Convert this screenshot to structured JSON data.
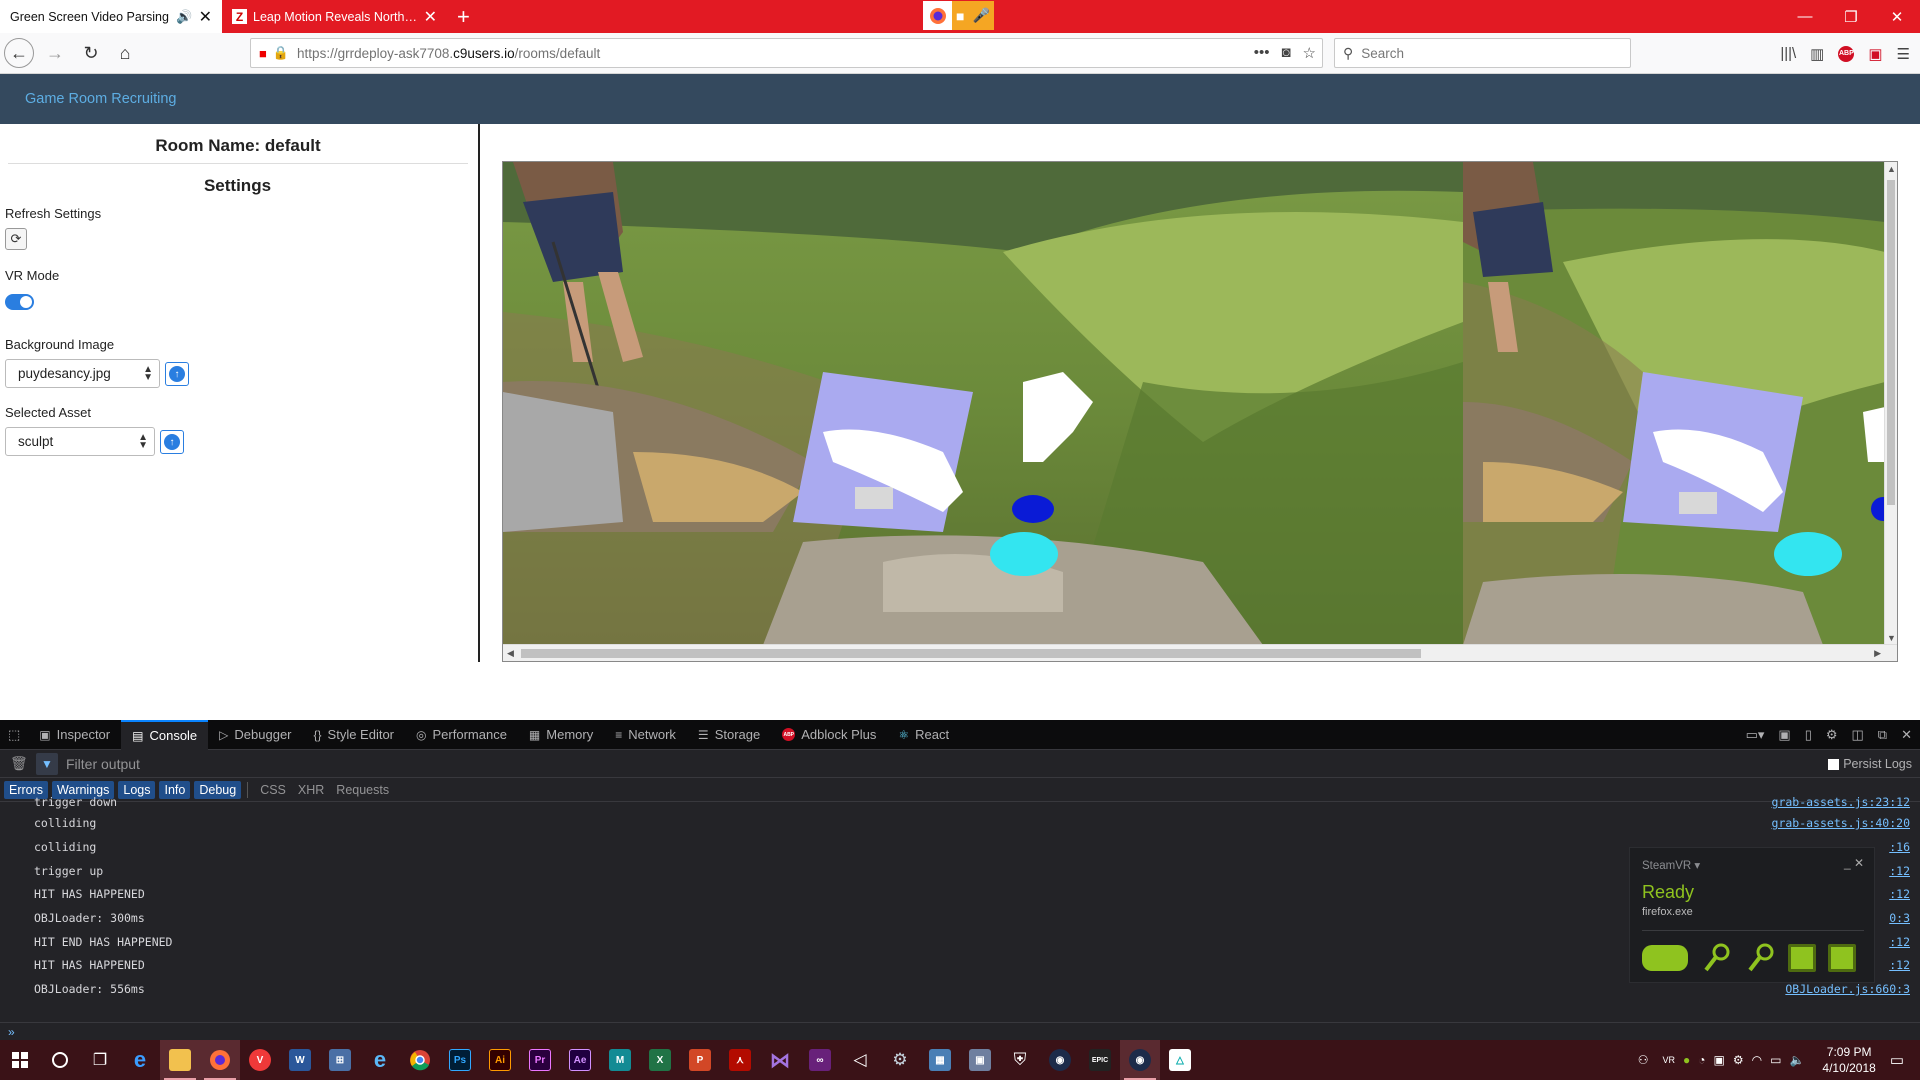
{
  "browser": {
    "tabs": [
      {
        "title": "Green Screen Video Parsing",
        "active": true
      },
      {
        "title": "Leap Motion Reveals North Star",
        "active": false
      }
    ],
    "url_prefix": "https://grrdeploy-ask7708.",
    "url_domain": "c9users.io",
    "url_suffix": "/rooms/default",
    "search_placeholder": "Search",
    "tab_close": "✕",
    "new_tab": "+",
    "abp_badge": "ABP",
    "urlbar_more": "•••"
  },
  "page": {
    "brand": "Game Room Recruiting",
    "room_name": "Room Name: default",
    "settings_heading": "Settings",
    "refresh_label": "Refresh Settings",
    "vr_mode_label": "VR Mode",
    "vr_mode_on": true,
    "background_label": "Background Image",
    "background_value": "puydesancy.jpg",
    "asset_label": "Selected Asset",
    "asset_value": "sculpt"
  },
  "devtools": {
    "tabs": [
      {
        "label": "Inspector",
        "icon": "inspector-icon"
      },
      {
        "label": "Console",
        "icon": "console-icon"
      },
      {
        "label": "Debugger",
        "icon": "debugger-icon"
      },
      {
        "label": "Style Editor",
        "icon": "style-editor-icon"
      },
      {
        "label": "Performance",
        "icon": "performance-icon"
      },
      {
        "label": "Memory",
        "icon": "memory-icon"
      },
      {
        "label": "Network",
        "icon": "network-icon"
      },
      {
        "label": "Storage",
        "icon": "storage-icon"
      },
      {
        "label": "Adblock Plus",
        "icon": "adblock-icon"
      },
      {
        "label": "React",
        "icon": "react-icon"
      }
    ],
    "active_tab": "Console",
    "filter_placeholder": "Filter output",
    "persist_logs": "Persist Logs",
    "levels_on": [
      "Errors",
      "Warnings",
      "Logs",
      "Info",
      "Debug"
    ],
    "levels_off": [
      "CSS",
      "XHR",
      "Requests"
    ],
    "log_lines": [
      {
        "text": "trigger down",
        "source": "grab-assets.js:23:12"
      },
      {
        "text": "colliding",
        "source": "grab-assets.js:40:20"
      },
      {
        "text": "colliding",
        "source": ":16"
      },
      {
        "text": "trigger up",
        "source": ":12"
      },
      {
        "text": "HIT HAS HAPPENED",
        "source": ":12"
      },
      {
        "text": "OBJLoader: 300ms",
        "source": "0:3"
      },
      {
        "text": "HIT END HAS HAPPENED",
        "source": ":12"
      },
      {
        "text": "HIT HAS HAPPENED",
        "source": ":12"
      },
      {
        "text": "OBJLoader: 556ms",
        "source": "OBJLoader.js:660:3"
      }
    ],
    "prompt": "»"
  },
  "steamvr": {
    "title": "SteamVR ▾",
    "status": "Ready",
    "process": "firefox.exe",
    "controls": "_  ✕"
  },
  "taskbar": {
    "time": "7:09 PM",
    "date": "4/10/2018",
    "apps": [
      "start",
      "cortana",
      "task-view",
      "edge",
      "file-explorer",
      "firefox",
      "vivaldi",
      "word",
      "network-app",
      "ie",
      "chrome",
      "photoshop",
      "illustrator",
      "premiere",
      "after-effects",
      "maya",
      "excel",
      "powerpoint",
      "acrobat",
      "visual-studio",
      "visual-studio-2",
      "unity",
      "steam",
      "calculator-app",
      "virtualbox",
      "defender",
      "oculus",
      "epic-games",
      "vr-app",
      "onedrive-app"
    ],
    "app_labels": {
      "word": "W",
      "ps": "Ps",
      "ai": "Ai",
      "pr": "Pr",
      "ae": "Ae",
      "maya": "M",
      "excel": "X",
      "ppt": "P",
      "epic": "EPIC"
    }
  },
  "colors": {
    "tabbar": "#e21a23",
    "pagenav": "#34495e",
    "brand_link": "#5dade2",
    "accent_blue": "#2a7ee0",
    "steam_green": "#8fc31f"
  }
}
